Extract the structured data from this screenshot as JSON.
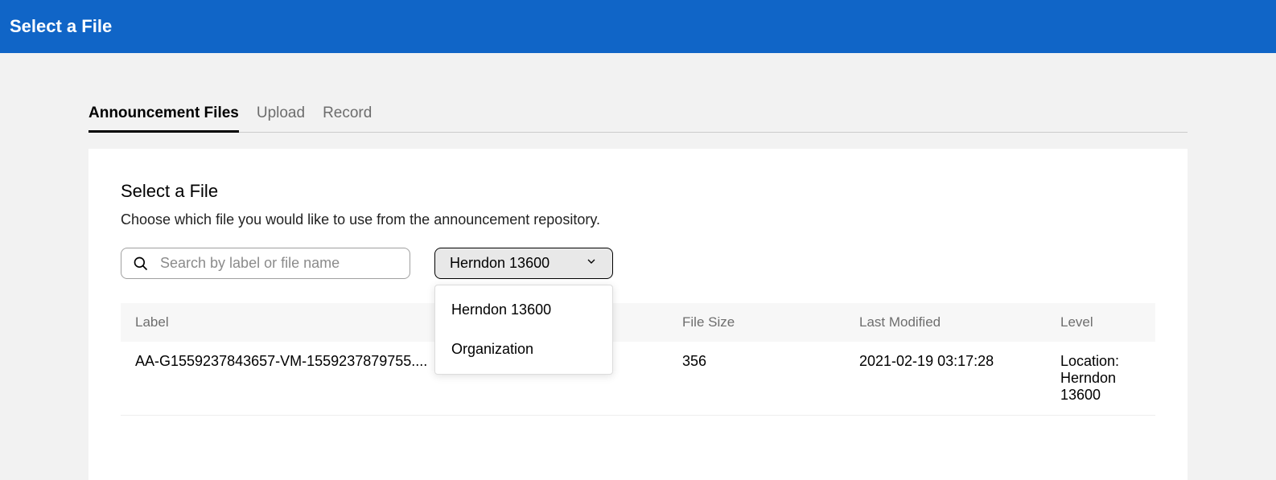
{
  "header": {
    "title": "Select a File"
  },
  "tabs": [
    {
      "label": "Announcement Files",
      "active": true
    },
    {
      "label": "Upload",
      "active": false
    },
    {
      "label": "Record",
      "active": false
    }
  ],
  "panel": {
    "title": "Select a File",
    "description": "Choose which file you would like to use from the announcement repository."
  },
  "search": {
    "placeholder": "Search by label or file name",
    "value": ""
  },
  "filter": {
    "selected": "Herndon 13600",
    "options": [
      "Herndon 13600",
      "Organization"
    ]
  },
  "table": {
    "headers": {
      "label": "Label",
      "size": "File Size",
      "modified": "Last Modified",
      "level": "Level"
    },
    "rows": [
      {
        "label": "AA-G1559237843657-VM-1559237879755....",
        "size": "356",
        "modified": "2021-02-19 03:17:28",
        "level": "Location: Herndon 13600"
      }
    ]
  }
}
